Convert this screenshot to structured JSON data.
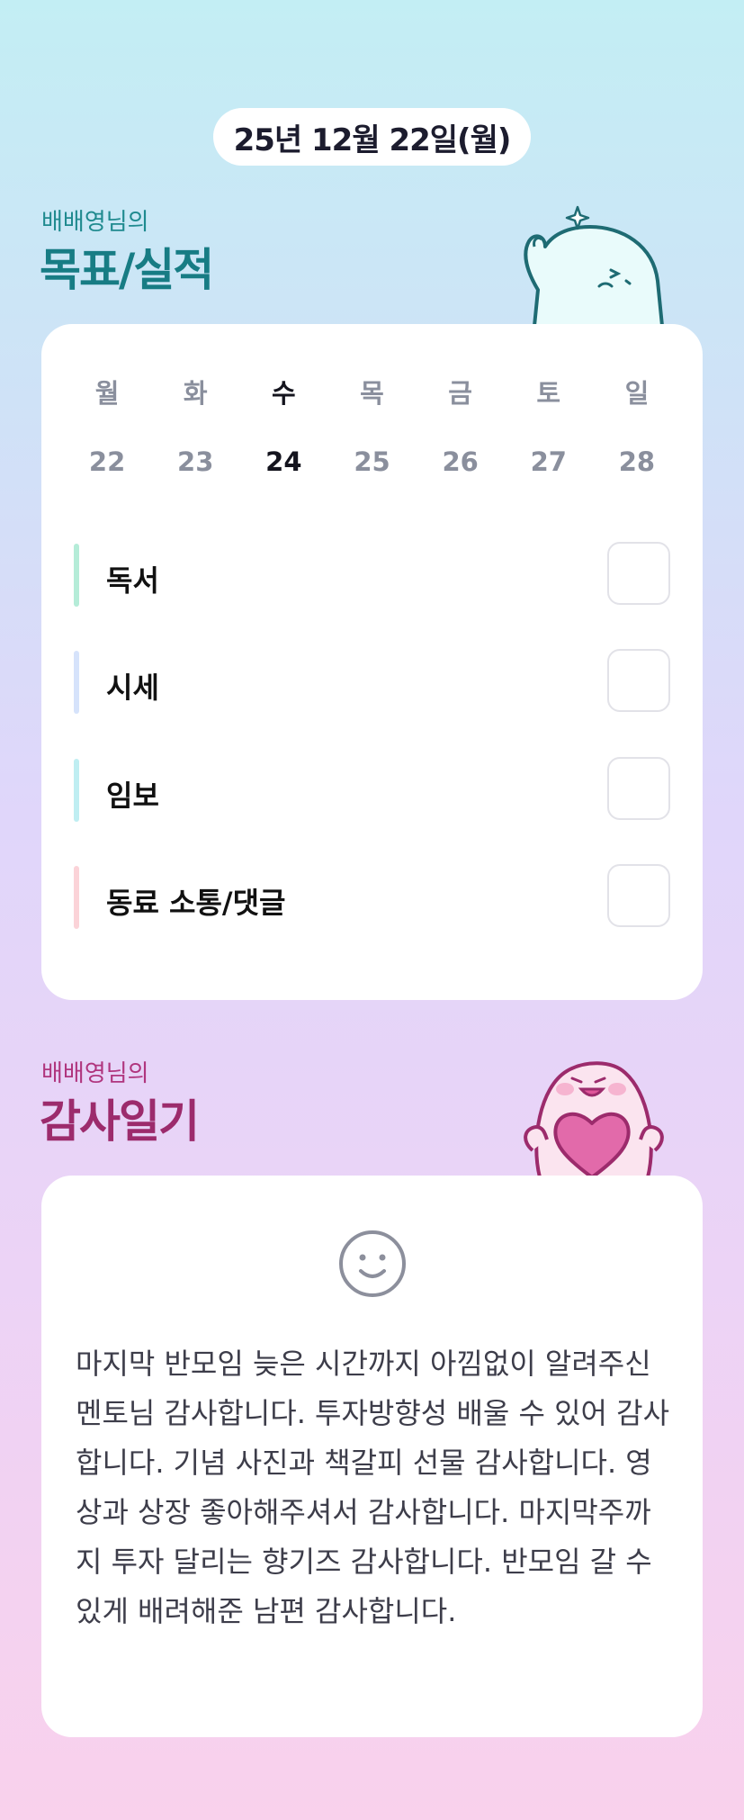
{
  "header": {
    "date": "25년 12월 22일(월)"
  },
  "goals": {
    "owner": "배배영님의",
    "title": "목표/실적",
    "weekdays": [
      "월",
      "화",
      "수",
      "목",
      "금",
      "토",
      "일"
    ],
    "dates": [
      "22",
      "23",
      "24",
      "25",
      "26",
      "27",
      "28"
    ],
    "today_index": 2,
    "items": [
      {
        "label": "독서",
        "color": "#b5ecd8",
        "checked": false
      },
      {
        "label": "시세",
        "color": "#d6e3fb",
        "checked": false
      },
      {
        "label": "임보",
        "color": "#bfeef2",
        "checked": false
      },
      {
        "label": "동료 소통/댓글",
        "color": "#fbd3d8",
        "checked": false
      }
    ]
  },
  "gratitude": {
    "owner": "배배영님의",
    "title": "감사일기",
    "mood_icon": "smile-face-icon",
    "text": "마지막 반모임 늦은 시간까지 아낌없이 알려주신 멘토님 감사합니다. 투자방향성 배울 수 있어 감사합니다. 기념 사진과 책갈피 선물 감사합니다. 영상과 상장 좋아해주셔서 감사합니다. 마지막주까지 투자 달리는 향기즈 감사합니다. 반모임 갈 수 있게 배려해준 남편 감사합니다."
  },
  "colors": {
    "goal_title": "#177c84",
    "gratitude_title": "#9c2b6c"
  }
}
